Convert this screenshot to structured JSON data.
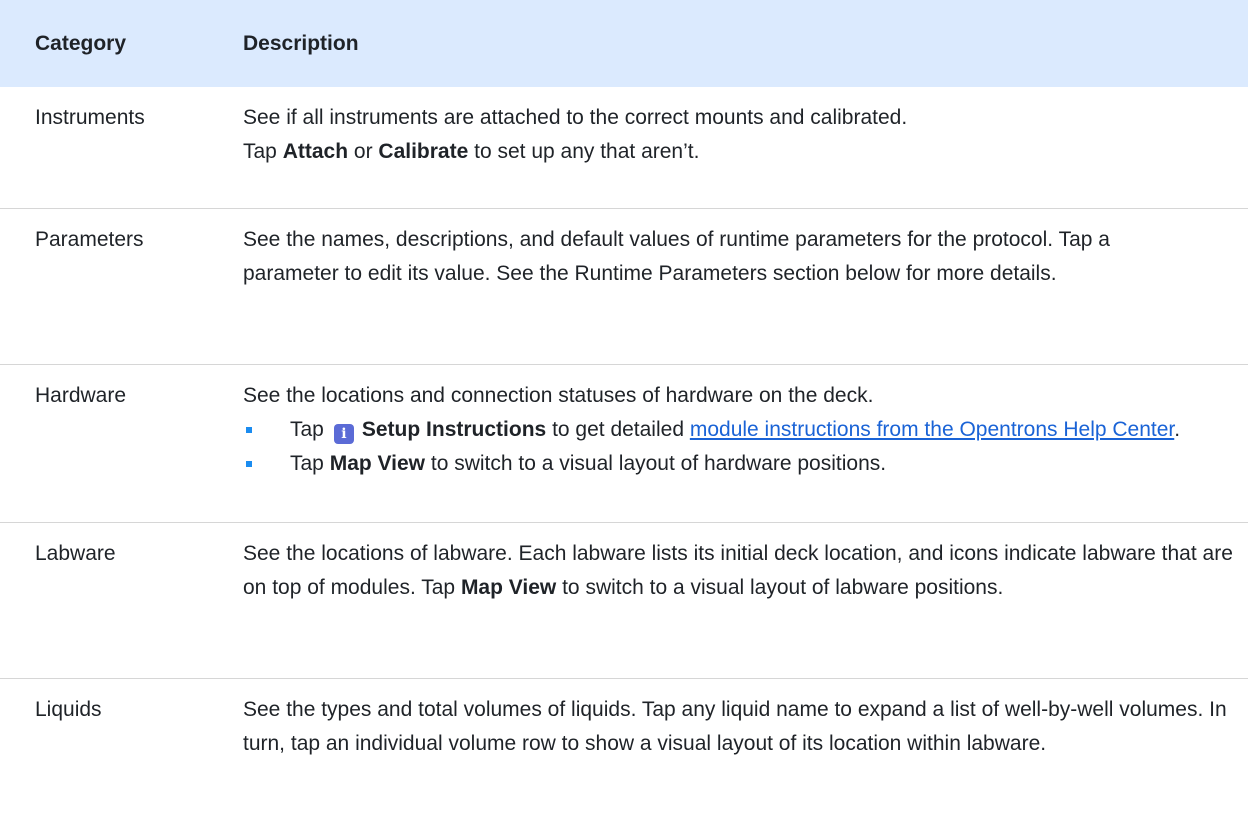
{
  "table": {
    "headers": {
      "category": "Category",
      "description": "Description"
    },
    "rows": {
      "instruments": {
        "category": "Instruments",
        "line1": "See if all instruments are attached to the correct mounts and calibrated.",
        "tap": "Tap",
        "attach": "Attach",
        "or": "or",
        "calibrate": "Calibrate",
        "end": "to set up any that aren’t."
      },
      "parameters": {
        "category": "Parameters",
        "text": "See the names, descriptions, and default values of runtime parameters for the protocol. Tap a parameter to edit its value. See the Runtime Parameters section below for more details."
      },
      "hardware": {
        "category": "Hardware",
        "intro": "See the locations and connection statuses of hardware on the deck.",
        "b1_tap": "Tap",
        "b1_icon": "info-icon",
        "b1_bold": "Setup Instructions",
        "b1_mid": "to get detailed",
        "b1_link": "module instructions from the Opentrons Help Center",
        "b1_end": ".",
        "b2_tap": "Tap",
        "b2_bold": "Map View",
        "b2_end": "to switch to a visual layout of hardware positions."
      },
      "labware": {
        "category": "Labware",
        "pre": "See the locations of labware. Each labware lists its initial deck location, and icons indicate labware that are on top of modules. Tap",
        "bold": "Map View",
        "post": "to switch to a visual layout of labware positions."
      },
      "liquids": {
        "category": "Liquids",
        "text": "See the types and total volumes of liquids. Tap any liquid name to expand a list of well-by-well volumes. In turn, tap an individual volume row to show a visual layout of its location within labware."
      }
    }
  },
  "colors": {
    "header_bg": "#dbeafe",
    "link": "#1a63d6",
    "bullet": "#1b8cf0"
  }
}
